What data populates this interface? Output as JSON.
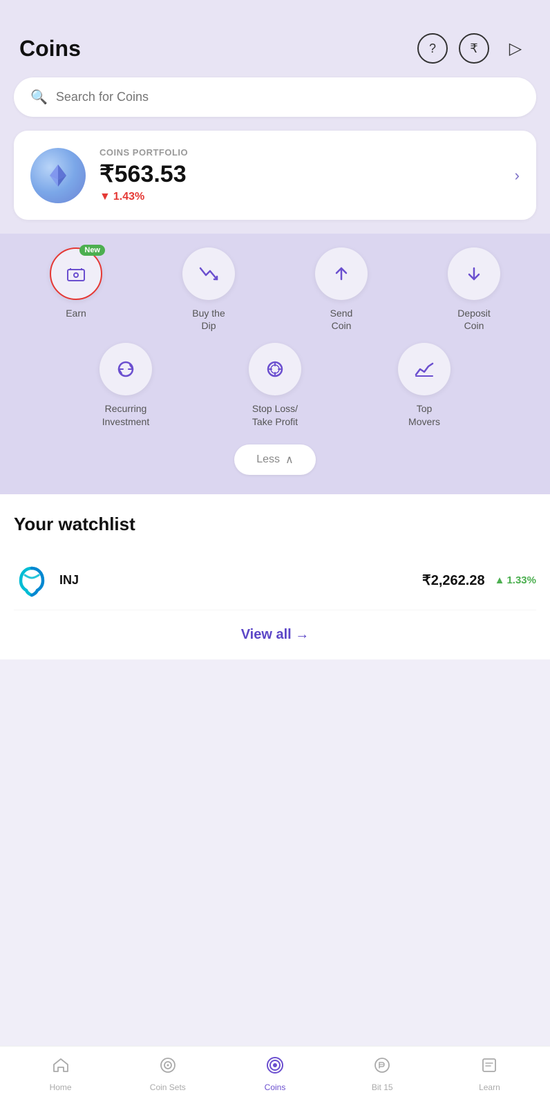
{
  "header": {
    "title": "Coins",
    "help_label": "help",
    "rupee_label": "rupee",
    "play_label": "play"
  },
  "search": {
    "placeholder": "Search for Coins"
  },
  "portfolio": {
    "label": "COINS PORTFOLIO",
    "value": "₹563.53",
    "change": "1.43%",
    "change_direction": "down"
  },
  "actions": {
    "row1": [
      {
        "id": "earn",
        "label": "Earn",
        "is_new": true,
        "highlighted": true
      },
      {
        "id": "buy-dip",
        "label": "Buy the\nDip",
        "is_new": false,
        "highlighted": false
      },
      {
        "id": "send-coin",
        "label": "Send\nCoin",
        "is_new": false,
        "highlighted": false
      },
      {
        "id": "deposit-coin",
        "label": "Deposit\nCoin",
        "is_new": false,
        "highlighted": false
      }
    ],
    "row2": [
      {
        "id": "recurring",
        "label": "Recurring\nInvestment",
        "is_new": false,
        "highlighted": false
      },
      {
        "id": "stop-loss",
        "label": "Stop Loss/\nTake Profit",
        "is_new": false,
        "highlighted": false
      },
      {
        "id": "top-movers",
        "label": "Top\nMovers",
        "is_new": false,
        "highlighted": false
      }
    ],
    "less_label": "Less"
  },
  "watchlist": {
    "title": "Your watchlist",
    "items": [
      {
        "symbol": "INJ",
        "name": "INJ",
        "price": "₹2,262.28",
        "change": "1.33%",
        "change_direction": "up"
      }
    ],
    "view_all": "View all →"
  },
  "bottom_nav": {
    "items": [
      {
        "id": "home",
        "label": "Home",
        "active": false
      },
      {
        "id": "coin-sets",
        "label": "Coin Sets",
        "active": false
      },
      {
        "id": "coins",
        "label": "Coins",
        "active": true
      },
      {
        "id": "bit15",
        "label": "Bit 15",
        "active": false
      },
      {
        "id": "learn",
        "label": "Learn",
        "active": false
      }
    ]
  }
}
